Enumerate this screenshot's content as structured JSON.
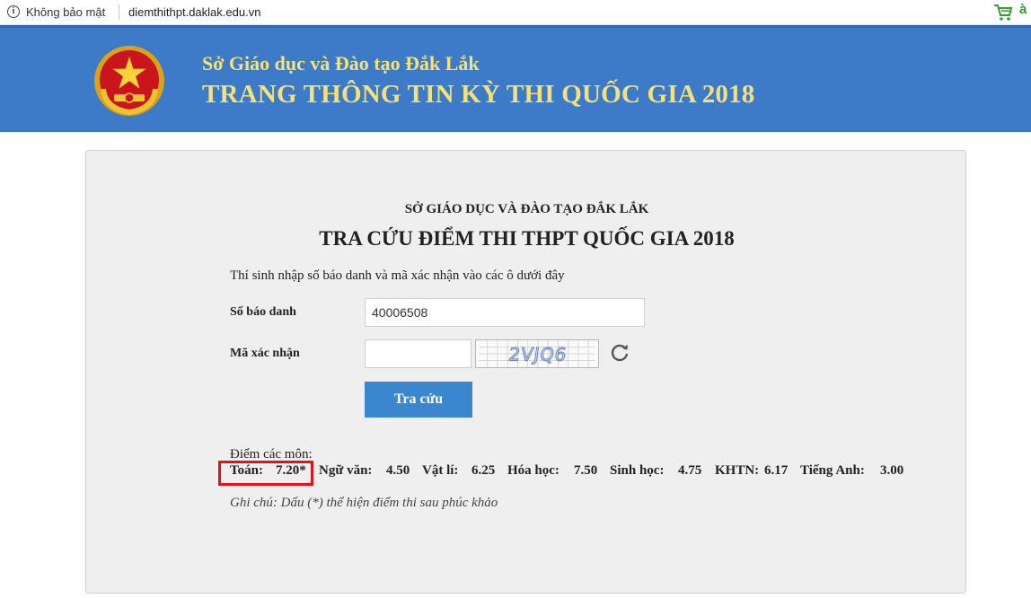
{
  "browser": {
    "security_label": "Không bảo mật",
    "url": "diemthithpt.daklak.edu.vn",
    "extension_letter": "à",
    "icons": [
      "info-icon",
      "cart-icon"
    ]
  },
  "banner": {
    "subtitle": "Sở Giáo dục và Đào tạo Đắk Lắk",
    "title": "TRANG THÔNG TIN KỲ THI QUỐC GIA 2018",
    "background": "#3d7ac7",
    "text_color": "#f3e27a",
    "logo": "national-emblem"
  },
  "form": {
    "department": "SỞ GIÁO DỤC VÀ ĐÀO TẠO ĐẮK LẮK",
    "title": "TRA CỨU ĐIỂM THI THPT QUỐC GIA 2018",
    "instruction": "Thí sinh nhập số báo danh và mã xác nhận vào các ô dưới đây",
    "sbd_label": "Số báo danh",
    "sbd_value": "40006508",
    "captcha_label": "Mã xác nhận",
    "captcha_value": "",
    "captcha_text": "2VJQ6",
    "refresh_icon": "refresh-icon",
    "submit_label": "Tra cứu",
    "button_color": "#3b87cf"
  },
  "results": {
    "label": "Điểm các môn:",
    "subjects": [
      {
        "name": "Toán:",
        "score": "7.20*"
      },
      {
        "name": "Ngữ văn:",
        "score": "4.50"
      },
      {
        "name": "Vật lí:",
        "score": "6.25"
      },
      {
        "name": "Hóa học:",
        "score": "7.50"
      },
      {
        "name": "Sinh học:",
        "score": "4.75"
      },
      {
        "name": "KHTN:",
        "score": "6.17"
      },
      {
        "name": "Tiếng Anh:",
        "score": "3.00"
      }
    ],
    "highlight_color": "#e8111b",
    "note": "Ghi chú: Dấu (*) thể hiện điểm thi sau phúc khảo"
  }
}
